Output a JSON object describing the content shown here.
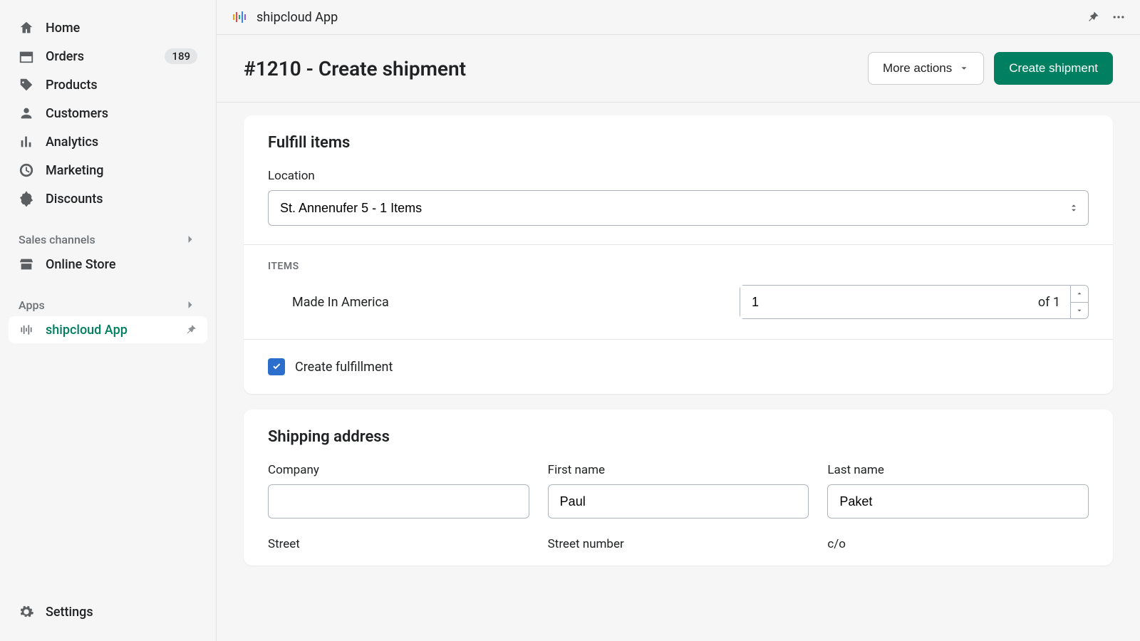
{
  "sidebar": {
    "items": [
      {
        "label": "Home"
      },
      {
        "label": "Orders",
        "badge": "189"
      },
      {
        "label": "Products"
      },
      {
        "label": "Customers"
      },
      {
        "label": "Analytics"
      },
      {
        "label": "Marketing"
      },
      {
        "label": "Discounts"
      }
    ],
    "groups": {
      "sales_channels": {
        "title": "Sales channels",
        "items": [
          {
            "label": "Online Store"
          }
        ]
      },
      "apps": {
        "title": "Apps",
        "items": [
          {
            "label": "shipcloud App"
          }
        ]
      }
    },
    "settings_label": "Settings"
  },
  "topbar": {
    "title": "shipcloud App"
  },
  "header": {
    "title": "#1210 - Create shipment",
    "more_actions_label": "More actions",
    "create_shipment_label": "Create shipment"
  },
  "fulfill": {
    "title": "Fulfill items",
    "location_label": "Location",
    "location_value": "St. Annenufer 5 - 1 Items",
    "items_header": "ITEMS",
    "item_name": "Made In America",
    "item_qty": "1",
    "item_total": "of 1",
    "create_fulfillment_label": "Create fulfillment"
  },
  "shipping": {
    "title": "Shipping address",
    "company_label": "Company",
    "company_value": "",
    "first_name_label": "First name",
    "first_name_value": "Paul",
    "last_name_label": "Last name",
    "last_name_value": "Paket",
    "street_label": "Street",
    "street_number_label": "Street number",
    "co_label": "c/o"
  }
}
